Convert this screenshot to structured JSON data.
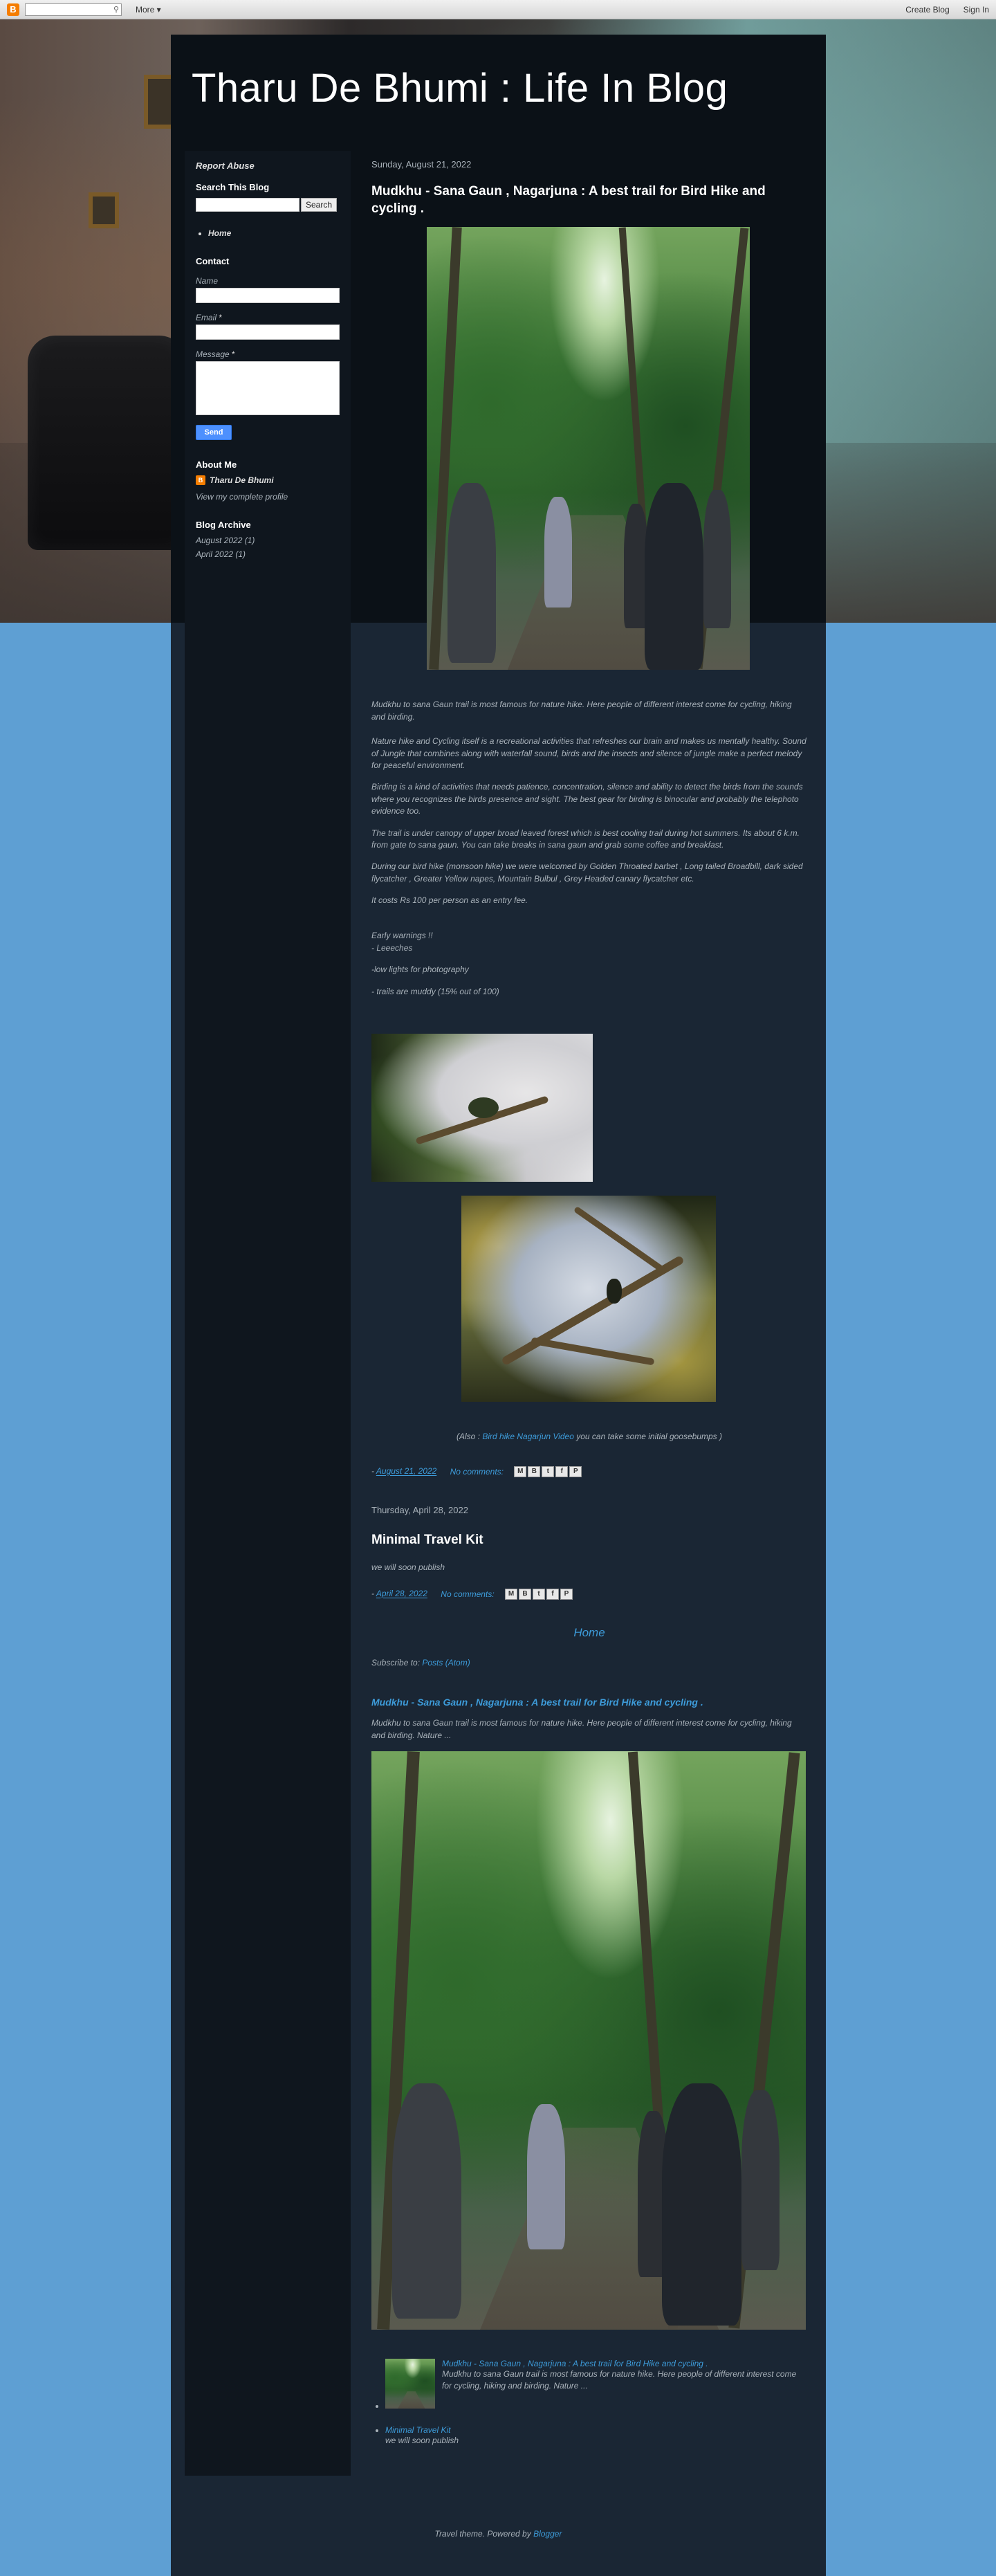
{
  "topbar": {
    "logo_letter": "B",
    "search_placeholder": "",
    "search_icon": "search-icon",
    "more_label": "More ▾",
    "create_blog": "Create Blog",
    "sign_in": "Sign In"
  },
  "blog": {
    "title": "Tharu De Bhumi : Life In Blog"
  },
  "sidebar": {
    "report_abuse": "Report Abuse",
    "search_heading": "Search This Blog",
    "search_button": "Search",
    "pages": [
      "Home"
    ],
    "contact_heading": "Contact",
    "name_label": "Name",
    "email_label": "Email",
    "message_label": "Message",
    "required_mark": "*",
    "send_button": "Send",
    "about_heading": "About Me",
    "author": "Tharu De Bhumi",
    "view_profile": "View my complete profile",
    "archive_heading": "Blog Archive",
    "archive": [
      "August 2022 (1)",
      "April 2022 (1)"
    ]
  },
  "posts": [
    {
      "date": "Sunday, August 21, 2022",
      "title": "Mudkhu - Sana Gaun , Nagarjuna : A best trail for Bird Hike and cycling .",
      "paragraphs": [
        " Mudkhu to sana Gaun trail is most famous for nature hike. Here people of different interest come for cycling, hiking and birding.",
        "Nature hike and Cycling  itself is a recreational activities that refreshes our brain and makes us mentally healthy. Sound of Jungle  that combines along with waterfall sound, birds and the insects and silence of jungle make a perfect melody for peaceful environment.",
        "Birding is a kind of activities that needs patience, concentration, silence and ability to detect the birds from the sounds where you recognizes the birds presence and sight. The best gear for birding is binocular and probably the telephoto evidence too.",
        "The trail is under canopy of upper broad leaved forest which is best cooling trail during hot summers. Its about 6 k.m. from gate to sana gaun. You can take breaks in sana gaun and grab some coffee and breakfast.",
        "During our bird hike (monsoon hike) we were welcomed by Golden Throated barbet , Long tailed Broadbill, dark sided flycatcher , Greater Yellow napes, Mountain Bulbul , Grey Headed canary flycatcher etc.",
        "It costs Rs 100 per person as an entry fee."
      ],
      "warnings": [
        "Early warnings !!",
        "- Leeeches",
        "-low lights for photography",
        "- trails are muddy (15% out of 100)"
      ],
      "also_prefix": "(Also : ",
      "also_link": "Bird hike Nagarjun Video",
      "also_suffix": " you can take some initial goosebumps )",
      "footer_prefix": "- ",
      "footer_date": "August 21, 2022",
      "comments": "No comments:"
    },
    {
      "date": "Thursday, April 28, 2022",
      "title": "Minimal Travel Kit",
      "body": " we will soon publish",
      "footer_prefix": "- ",
      "footer_date": "April 28, 2022",
      "comments": "No comments:"
    }
  ],
  "share_icons": [
    "M",
    "B",
    "t",
    "f",
    "P"
  ],
  "home_link": "Home",
  "subscribe_prefix": "Subscribe to: ",
  "subscribe_link": "Posts (Atom)",
  "popular": {
    "featured_title": "Mudkhu - Sana Gaun , Nagarjuna : A best trail for Bird Hike and cycling .",
    "featured_snippet": "  Mudkhu to sana Gaun trail is most famous for nature hike. Here people of different interest come for cycling, hiking and birding.  Nature ...",
    "items": [
      {
        "title": "Mudkhu - Sana Gaun , Nagarjuna : A best trail for Bird Hike and cycling .",
        "snippet": "  Mudkhu to sana Gaun trail is most famous for nature hike. Here people of different interest come for cycling, hiking and birding.  Nature ..."
      },
      {
        "title": "Minimal Travel Kit",
        "snippet": " we will soon publish"
      }
    ]
  },
  "attribution_prefix": "Travel theme. Powered by ",
  "attribution_link": "Blogger"
}
